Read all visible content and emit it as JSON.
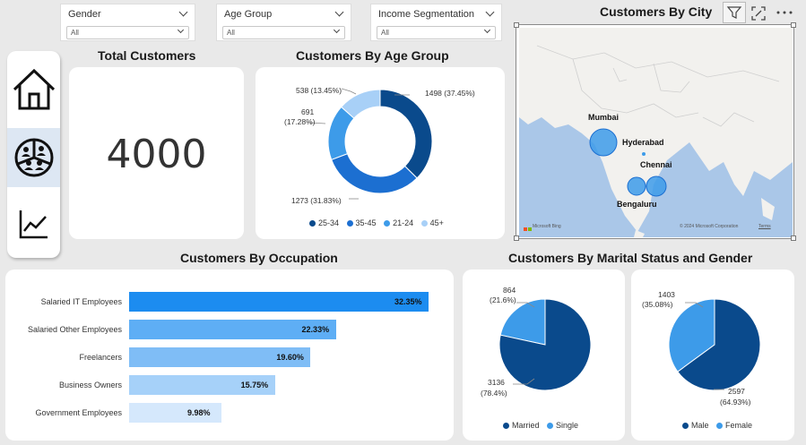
{
  "slicers": [
    {
      "label": "Gender",
      "value": "All"
    },
    {
      "label": "Age Group",
      "value": "All"
    },
    {
      "label": "Income Segmentation",
      "value": "All"
    }
  ],
  "nav": {
    "items": [
      "home-icon",
      "customers-icon",
      "trend-chart-icon"
    ],
    "active": 1
  },
  "total_customers": {
    "title": "Total Customers",
    "value": "4000"
  },
  "age_group": {
    "title": "Customers By Age Group",
    "labels": [
      "1498 (37.45%)",
      "1273 (31.83%)",
      "691",
      "(17.28%)",
      "538 (13.45%)"
    ],
    "legend": [
      "25-34",
      "35-45",
      "21-24",
      "45+"
    ]
  },
  "city": {
    "title": "Customers By City",
    "labels": [
      "Mumbai",
      "Hyderabad",
      "Chennai",
      "Bengaluru"
    ],
    "attribution": "© 2024 Microsoft Corporation",
    "terms": "Terms",
    "brand": "Microsoft Bing"
  },
  "occupation": {
    "title": "Customers By Occupation",
    "rows": [
      {
        "label": "Salaried IT Employees",
        "pct": "32.35%"
      },
      {
        "label": "Salaried Other Employees",
        "pct": "22.33%"
      },
      {
        "label": "Freelancers",
        "pct": "19.60%"
      },
      {
        "label": "Business Owners",
        "pct": "15.75%"
      },
      {
        "label": "Government Employees",
        "pct": "9.98%"
      }
    ]
  },
  "marital": {
    "title": "Customers By Marital Status and Gender",
    "marital_labels": [
      "864",
      "(21.6%)",
      "3136",
      "(78.4%)"
    ],
    "marital_legend": [
      "Married",
      "Single"
    ],
    "gender_labels": [
      "1403",
      "(35.08%)",
      "2597",
      "(64.93%)"
    ],
    "gender_legend": [
      "Male",
      "Female"
    ]
  },
  "colors": {
    "dark": "#0a4a8c",
    "mid": "#1c6fd1",
    "light": "#3d9be9",
    "pale": "#a8d0f7"
  },
  "chart_data": [
    {
      "type": "pie",
      "title": "Customers By Age Group",
      "categories": [
        "25-34",
        "35-45",
        "21-24",
        "45+"
      ],
      "values": [
        1498,
        1273,
        691,
        538
      ],
      "percent": [
        37.45,
        31.83,
        17.28,
        13.45
      ]
    },
    {
      "type": "bar",
      "title": "Customers By Occupation",
      "categories": [
        "Salaried IT Employees",
        "Salaried Other Employees",
        "Freelancers",
        "Business Owners",
        "Government Employees"
      ],
      "values": [
        32.35,
        22.33,
        19.6,
        15.75,
        9.98
      ]
    },
    {
      "type": "pie",
      "title": "Customers By Marital Status",
      "categories": [
        "Married",
        "Single"
      ],
      "values": [
        3136,
        864
      ],
      "percent": [
        78.4,
        21.6
      ]
    },
    {
      "type": "pie",
      "title": "Customers By Gender",
      "categories": [
        "Male",
        "Female"
      ],
      "values": [
        2597,
        1403
      ],
      "percent": [
        64.93,
        35.08
      ]
    }
  ]
}
